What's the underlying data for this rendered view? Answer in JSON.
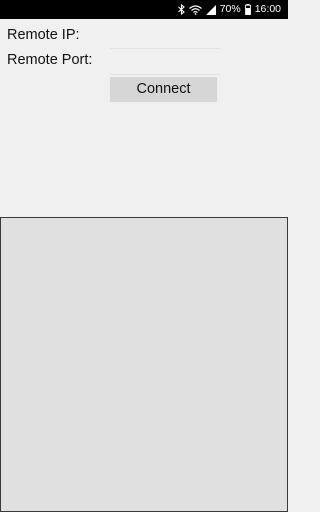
{
  "status_bar": {
    "battery_percent": "70%",
    "time": "16:00",
    "icons": [
      "bluetooth-icon",
      "wifi-icon",
      "signal-icon",
      "battery-icon"
    ],
    "background": "#000000"
  },
  "form": {
    "remote_ip_label": "Remote IP:",
    "remote_ip_value": "",
    "remote_port_label": "Remote Port:",
    "remote_port_value": "",
    "connect_label": "Connect"
  },
  "colors": {
    "background": "#f0f0f0",
    "button": "#d6d6d6",
    "panel": "#e0e0e0",
    "panel_border": "#3a3a3a"
  }
}
